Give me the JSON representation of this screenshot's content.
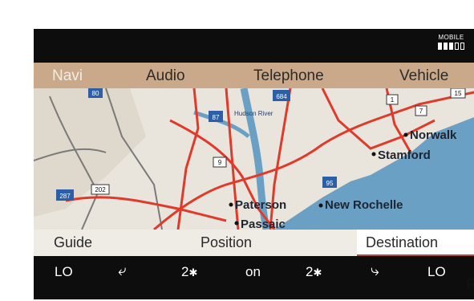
{
  "status": {
    "mobile_label": "MOBILE",
    "signal_bars_filled": 3,
    "signal_bars_total": 5
  },
  "menu": {
    "navi": "Navi",
    "audio": "Audio",
    "telephone": "Telephone",
    "vehicle": "Vehicle"
  },
  "map": {
    "cities": {
      "norwalk": "Norwalk",
      "stamford": "Stamford",
      "paterson": "Paterson",
      "new_rochelle": "New Rochelle",
      "passaic": "Passaic"
    },
    "river": "Hudson River",
    "shields": {
      "i287": "287",
      "i684": "684",
      "i87": "87",
      "i95": "95",
      "r1": "1",
      "r7": "7",
      "r15": "15",
      "r9": "9",
      "i80": "80",
      "r202": "202"
    }
  },
  "submenu": {
    "guide": "Guide",
    "position": "Position",
    "destination": "Destination"
  },
  "climate": {
    "left_temp": "LO",
    "left_fan": "2",
    "ac": "on",
    "right_fan": "2",
    "right_temp": "LO"
  },
  "caption_fragment": "F",
  "colors": {
    "menu_bar": "#c9a98a",
    "water": "#6aa0c4",
    "land": "#e9e4dc",
    "road": "#e03a2a"
  }
}
